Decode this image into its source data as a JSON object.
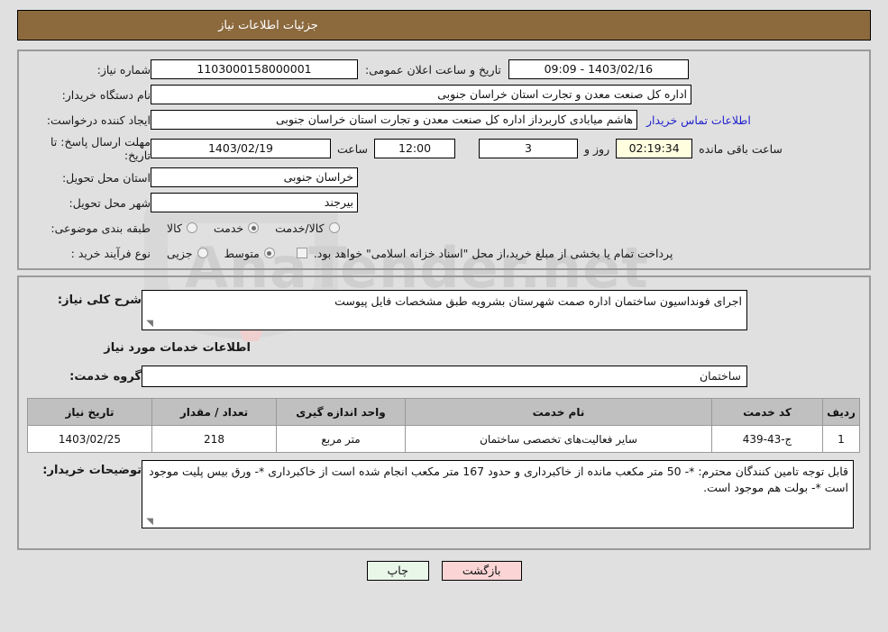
{
  "header": {
    "title": "جزئیات اطلاعات نیاز"
  },
  "top_form": {
    "need_number": {
      "label": "شماره نیاز:",
      "value": "1103000158000001"
    },
    "public_announce": {
      "label": "تاریخ و ساعت اعلان عمومی:",
      "value": "1403/02/16 - 09:09"
    },
    "buyer_org": {
      "label": "نام دستگاه خریدار:",
      "value": "اداره کل صنعت  معدن و تجارت استان خراسان جنوبی"
    },
    "creator": {
      "label": "ایجاد کننده درخواست:",
      "value": "هاشم میابادی کاربرداز اداره کل صنعت  معدن و تجارت استان خراسان جنوبی"
    },
    "contact_link": "اطلاعات تماس خریدار",
    "deadline": {
      "label": "مهلت ارسال پاسخ: تا تاریخ:",
      "date": "1403/02/19",
      "time_label": "ساعت",
      "time": "12:00",
      "days": "3",
      "days_suffix": "روز و",
      "timer": "02:19:34",
      "timer_suffix": "ساعت باقی مانده"
    },
    "province": {
      "label": "استان محل تحویل:",
      "value": "خراسان جنوبی"
    },
    "city": {
      "label": "شهر محل تحویل:",
      "value": "بیرجند"
    },
    "category": {
      "label": "طبقه بندی موضوعی:",
      "options": [
        {
          "label": "کالا",
          "selected": false
        },
        {
          "label": "خدمت",
          "selected": true
        },
        {
          "label": "کالا/خدمت",
          "selected": false
        }
      ]
    },
    "purchase_type": {
      "label": "نوع فرآیند خرید :",
      "options": [
        {
          "label": "جزیی",
          "selected": false
        },
        {
          "label": "متوسط",
          "selected": true
        }
      ],
      "checkbox_label": "پرداخت تمام یا بخشی از مبلغ خرید،از محل \"اسناد خزانه اسلامی\" خواهد بود.",
      "checkbox_checked": false
    }
  },
  "bottom_form": {
    "general_desc": {
      "label": "شرح کلی نیاز:",
      "value": "اجرای فونداسیون ساختمان اداره صمت شهرستان بشرویه طبق مشخصات فایل پیوست"
    },
    "services_section_title": "اطلاعات خدمات مورد نیاز",
    "service_group": {
      "label": "گروه خدمت:",
      "value": "ساختمان"
    },
    "table": {
      "columns": [
        "ردیف",
        "کد خدمت",
        "نام خدمت",
        "واحد اندازه گیری",
        "تعداد / مقدار",
        "تاریخ نیاز"
      ],
      "rows": [
        {
          "radif": "1",
          "code": "ج-43-439",
          "name": "سایر فعالیت‌های تخصصی ساختمان",
          "unit": "متر مربع",
          "qty": "218",
          "date": "1403/02/25"
        }
      ]
    },
    "buyer_notes": {
      "label": "توضیحات خریدار:",
      "value": "قابل توجه تامین کنندگان محترم: *- 50 متر مکعب مانده از خاکبرداری و حدود 167 متر مکعب انجام شده است از خاکبرداری *- ورق بیس پلیت موجود است *- بولت هم موجود است."
    }
  },
  "footer": {
    "print_label": "چاپ",
    "back_label": "بازگشت"
  },
  "colors": {
    "header_bg": "#8c6a3e",
    "page_bg": "#e0e0e0",
    "link": "#2222cc",
    "timer_bg": "#ffffe0",
    "table_header_bg": "#c0c0c0",
    "print_btn_bg": "#e9f7e9",
    "back_btn_bg": "#fbd5d5"
  }
}
